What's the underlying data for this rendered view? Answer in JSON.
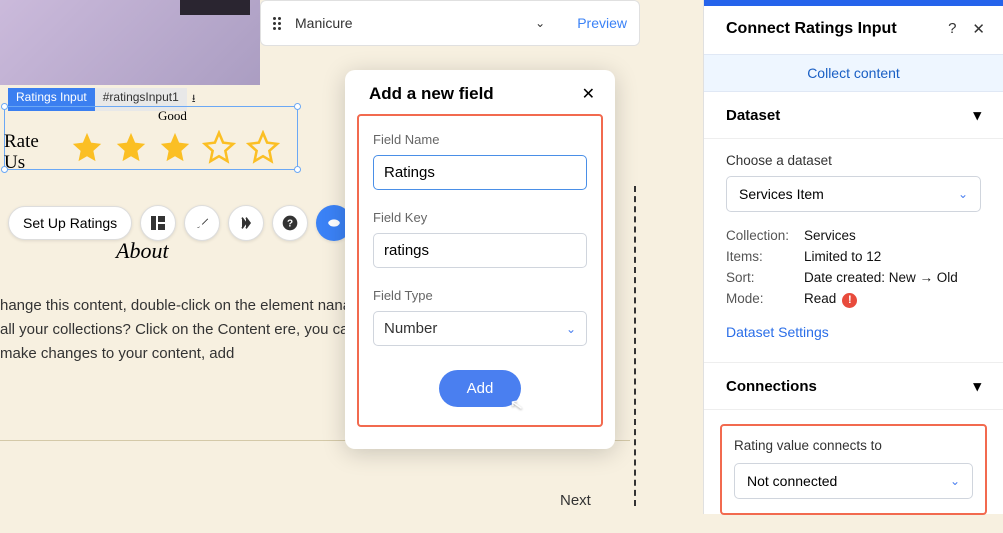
{
  "top_bar": {
    "label": "Manicure",
    "preview": "Preview"
  },
  "ratings_component": {
    "tag_type": "Ratings Input",
    "tag_id": "#ratingsInput1",
    "good": "Good",
    "rate_us_line1": "Rate",
    "rate_us_line2": "Us"
  },
  "toolbar": {
    "setup": "Set Up Ratings"
  },
  "about": {
    "heading": "About",
    "body": "hange this content, double-click on the element nanage all your collections? Click on the Content ere, you can make changes to your content, add"
  },
  "next": "Next",
  "modal": {
    "title": "Add a new field",
    "field_name_label": "Field Name",
    "field_name_value": "Ratings",
    "field_key_label": "Field Key",
    "field_key_value": "ratings",
    "field_type_label": "Field Type",
    "field_type_value": "Number",
    "add_button": "Add"
  },
  "panel": {
    "title": "Connect Ratings Input",
    "collect": "Collect content",
    "dataset_section": "Dataset",
    "choose_label": "Choose a dataset",
    "dataset_value": "Services Item",
    "meta": {
      "collection_k": "Collection:",
      "collection_v": "Services",
      "items_k": "Items:",
      "items_v": "Limited to 12",
      "sort_k": "Sort:",
      "sort_v": "Date created: New → Old",
      "mode_k": "Mode:",
      "mode_v": "Read"
    },
    "dataset_settings": "Dataset Settings",
    "connections_section": "Connections",
    "rating_connects_label": "Rating value connects to",
    "rating_connects_value": "Not connected"
  }
}
